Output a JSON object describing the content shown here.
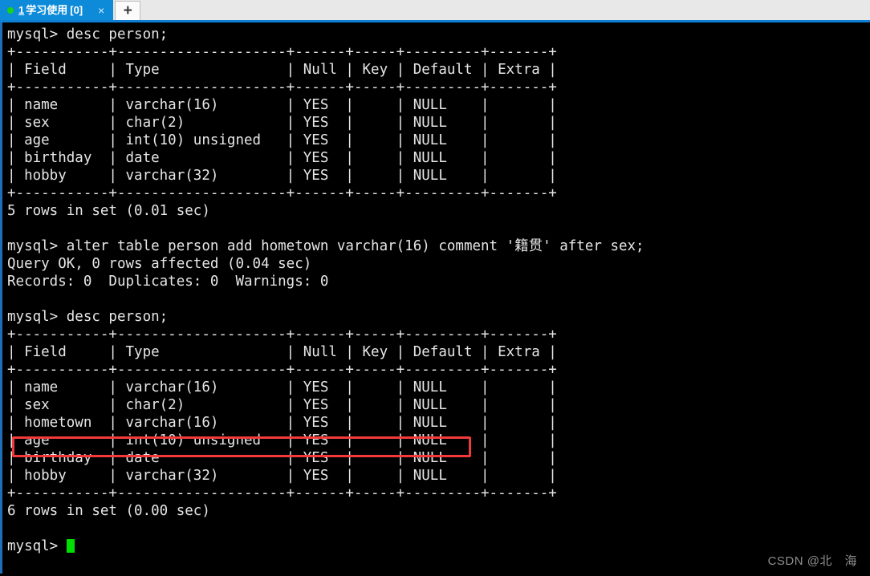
{
  "window": {
    "accent_blue": "#0d8bd9",
    "tabbar_bg": "#e8e8e8",
    "terminal_bg": "#000000",
    "terminal_fg": "#e6e6e6",
    "cursor_color": "#00e000",
    "highlight_color": "#f33a3a"
  },
  "tabbar": {
    "tab": {
      "status_dot": "green-dot-icon",
      "index": "1",
      "title": "学习使用",
      "count": "[0]",
      "close_label": "×"
    },
    "new_tab_label": "+"
  },
  "terminal": {
    "lines": [
      "mysql> desc person;",
      "+-----------+--------------------+------+-----+---------+-------+",
      "| Field     | Type               | Null | Key | Default | Extra |",
      "+-----------+--------------------+------+-----+---------+-------+",
      "| name      | varchar(16)        | YES  |     | NULL    |       |",
      "| sex       | char(2)            | YES  |     | NULL    |       |",
      "| age       | int(10) unsigned   | YES  |     | NULL    |       |",
      "| birthday  | date               | YES  |     | NULL    |       |",
      "| hobby     | varchar(32)        | YES  |     | NULL    |       |",
      "+-----------+--------------------+------+-----+---------+-------+",
      "5 rows in set (0.01 sec)",
      "",
      "mysql> alter table person add hometown varchar(16) comment '籍贯' after sex;",
      "Query OK, 0 rows affected (0.04 sec)",
      "Records: 0  Duplicates: 0  Warnings: 0",
      "",
      "mysql> desc person;",
      "+-----------+--------------------+------+-----+---------+-------+",
      "| Field     | Type               | Null | Key | Default | Extra |",
      "+-----------+--------------------+------+-----+---------+-------+",
      "| name      | varchar(16)        | YES  |     | NULL    |       |",
      "| sex       | char(2)            | YES  |     | NULL    |       |",
      "| hometown  | varchar(16)        | YES  |     | NULL    |       |",
      "| age       | int(10) unsigned   | YES  |     | NULL    |       |",
      "| birthday  | date               | YES  |     | NULL    |       |",
      "| hobby     | varchar(32)        | YES  |     | NULL    |       |",
      "+-----------+--------------------+------+-----+---------+-------+",
      "6 rows in set (0.00 sec)",
      "",
      "mysql> "
    ],
    "prompt_last": "mysql> ",
    "tables": [
      {
        "query": "desc person;",
        "columns": [
          "Field",
          "Type",
          "Null",
          "Key",
          "Default",
          "Extra"
        ],
        "rows": [
          [
            "name",
            "varchar(16)",
            "YES",
            "",
            "NULL",
            ""
          ],
          [
            "sex",
            "char(2)",
            "YES",
            "",
            "NULL",
            ""
          ],
          [
            "age",
            "int(10) unsigned",
            "YES",
            "",
            "NULL",
            ""
          ],
          [
            "birthday",
            "date",
            "YES",
            "",
            "NULL",
            ""
          ],
          [
            "hobby",
            "varchar(32)",
            "YES",
            "",
            "NULL",
            ""
          ]
        ],
        "result": "5 rows in set (0.01 sec)"
      },
      {
        "query": "desc person;",
        "columns": [
          "Field",
          "Type",
          "Null",
          "Key",
          "Default",
          "Extra"
        ],
        "rows": [
          [
            "name",
            "varchar(16)",
            "YES",
            "",
            "NULL",
            ""
          ],
          [
            "sex",
            "char(2)",
            "YES",
            "",
            "NULL",
            ""
          ],
          [
            "hometown",
            "varchar(16)",
            "YES",
            "",
            "NULL",
            ""
          ],
          [
            "age",
            "int(10) unsigned",
            "YES",
            "",
            "NULL",
            ""
          ],
          [
            "birthday",
            "date",
            "YES",
            "",
            "NULL",
            ""
          ],
          [
            "hobby",
            "varchar(32)",
            "YES",
            "",
            "NULL",
            ""
          ]
        ],
        "result": "6 rows in set (0.00 sec)",
        "highlighted_row": "hometown"
      }
    ],
    "alter_statement": {
      "command": "alter table person add hometown varchar(16) comment '籍贯' after sex;",
      "status": "Query OK, 0 rows affected (0.04 sec)",
      "records": "Records: 0  Duplicates: 0  Warnings: 0"
    }
  },
  "watermark": {
    "text": "CSDN @北　海"
  }
}
